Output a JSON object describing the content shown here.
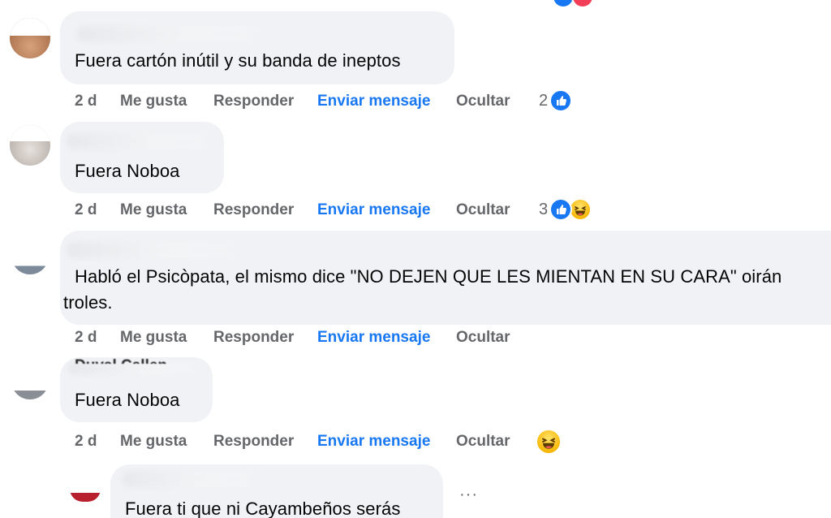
{
  "comments": [
    {
      "text": "Fuera cartón inútil y su banda de ineptos",
      "time": "2 d",
      "like_label": "Me gusta",
      "reply_label": "Responder",
      "message_label": "Enviar mensaje",
      "hide_label": "Ocultar",
      "reaction_count": "2",
      "reactions": [
        "like-icon"
      ]
    },
    {
      "text": "Fuera Noboa",
      "time": "2 d",
      "like_label": "Me gusta",
      "reply_label": "Responder",
      "message_label": "Enviar mensaje",
      "hide_label": "Ocultar",
      "reaction_count": "3",
      "reactions": [
        "like-icon",
        "haha-icon"
      ]
    },
    {
      "text_line1": "Habló el Psicòpata, el mismo dice \"NO DEJEN QUE LES MIENTAN EN SU CARA\" oirán",
      "text_line2": "troles.",
      "time": "2 d",
      "like_label": "Me gusta",
      "reply_label": "Responder",
      "message_label": "Enviar mensaje",
      "hide_label": "Ocultar"
    },
    {
      "author_partial": "Duval Callen",
      "text": "Fuera Noboa",
      "time": "2 d",
      "like_label": "Me gusta",
      "reply_label": "Responder",
      "message_label": "Enviar mensaje",
      "hide_label": "Ocultar",
      "reactions": [
        "haha-icon"
      ]
    },
    {
      "text": "Fuera ti que ni Cayambeños serás",
      "more_label": "···"
    }
  ],
  "colors": {
    "bubble_bg": "#f0f2f5",
    "text": "#050505",
    "meta": "#65676b",
    "link": "#1877f2"
  }
}
